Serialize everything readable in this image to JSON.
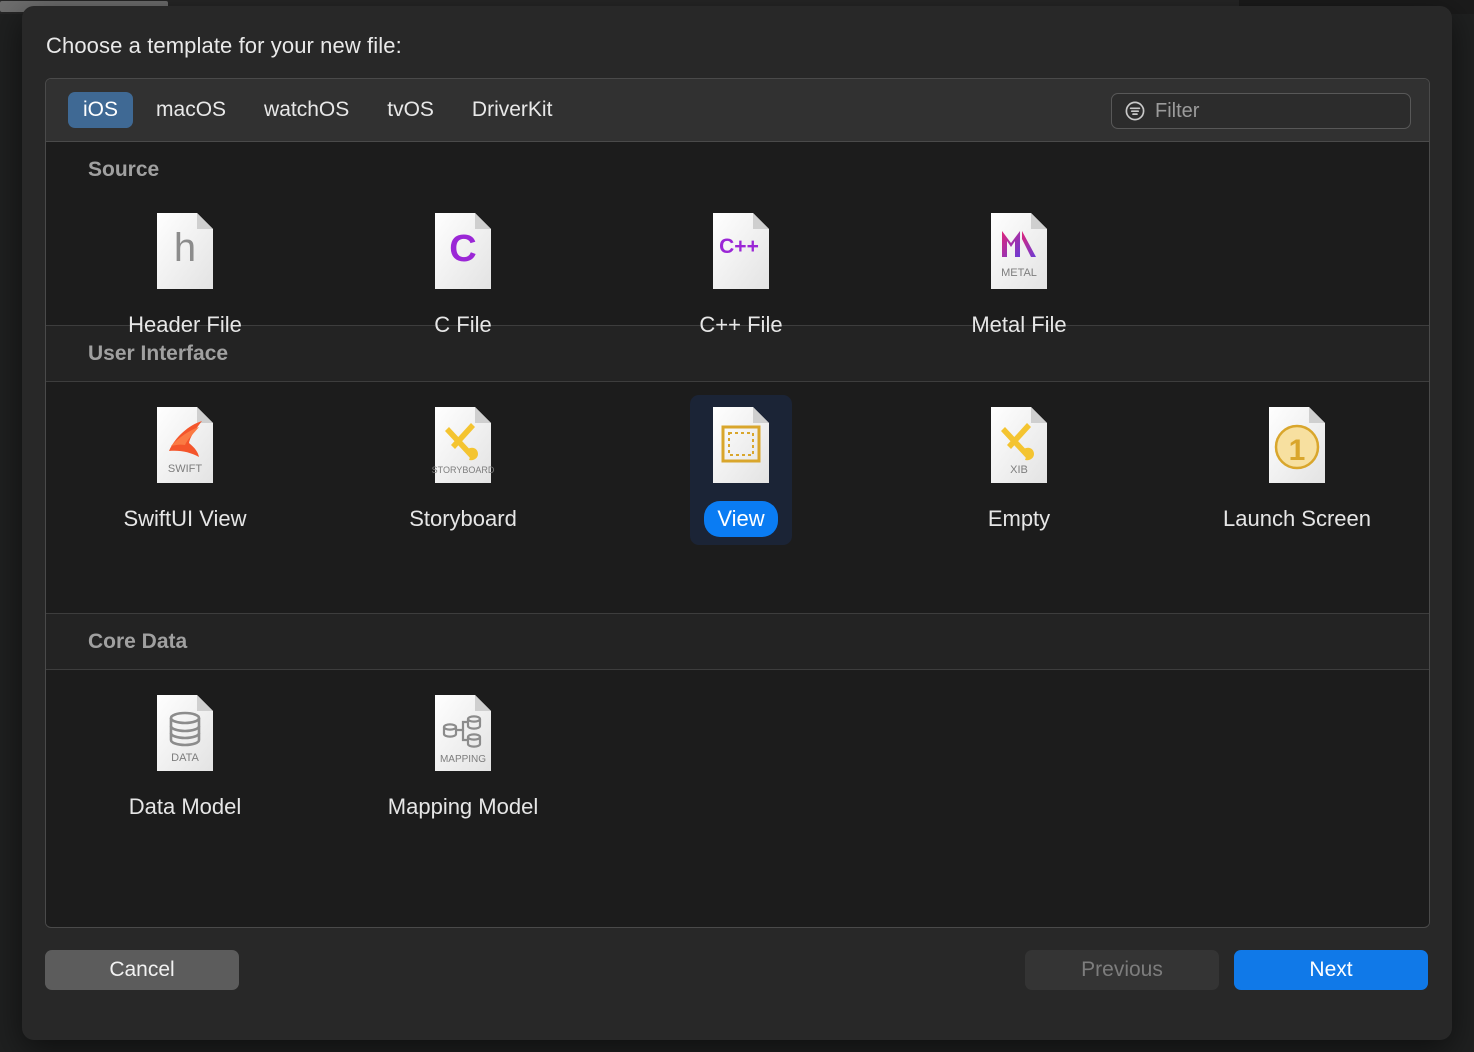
{
  "window": {
    "sheet_title": "Choose a template for your new file:"
  },
  "platform_tabs": [
    {
      "label": "iOS",
      "selected": true
    },
    {
      "label": "macOS",
      "selected": false
    },
    {
      "label": "watchOS",
      "selected": false
    },
    {
      "label": "tvOS",
      "selected": false
    },
    {
      "label": "DriverKit",
      "selected": false
    }
  ],
  "filter": {
    "value": "",
    "placeholder": "Filter",
    "icon": "filter-icon"
  },
  "sections": [
    {
      "title": "Source",
      "items": [
        {
          "label": "Header File",
          "icon": "header-file-icon",
          "badge": "h",
          "selected": false
        },
        {
          "label": "C File",
          "icon": "c-file-icon",
          "badge": "C",
          "selected": false
        },
        {
          "label": "C++ File",
          "icon": "cpp-file-icon",
          "badge": "C++",
          "selected": false
        },
        {
          "label": "Metal File",
          "icon": "metal-file-icon",
          "badge": "METAL",
          "selected": false
        }
      ]
    },
    {
      "title": "User Interface",
      "items": [
        {
          "label": "SwiftUI View",
          "icon": "swiftui-view-icon",
          "badge": "SWIFT",
          "selected": false
        },
        {
          "label": "Storyboard",
          "icon": "storyboard-icon",
          "badge": "STORYBOARD",
          "selected": false
        },
        {
          "label": "View",
          "icon": "view-icon",
          "badge": "",
          "selected": true
        },
        {
          "label": "Empty",
          "icon": "xib-empty-icon",
          "badge": "XIB",
          "selected": false
        },
        {
          "label": "Launch Screen",
          "icon": "launch-screen-icon",
          "badge": "",
          "selected": false
        }
      ]
    },
    {
      "title": "Core Data",
      "items": [
        {
          "label": "Data Model",
          "icon": "data-model-icon",
          "badge": "DATA",
          "selected": false
        },
        {
          "label": "Mapping Model",
          "icon": "mapping-model-icon",
          "badge": "MAPPING",
          "selected": false
        }
      ]
    }
  ],
  "buttons": {
    "cancel": {
      "label": "Cancel",
      "enabled": true
    },
    "previous": {
      "label": "Previous",
      "enabled": false
    },
    "next": {
      "label": "Next",
      "enabled": true,
      "default": true
    }
  },
  "colors": {
    "accent_blue": "#0a7cf3",
    "tab_selected": "#3f6994",
    "sheet_background": "#282828",
    "panel_background": "#1c1c1c",
    "selection_background": "#1b2436"
  }
}
